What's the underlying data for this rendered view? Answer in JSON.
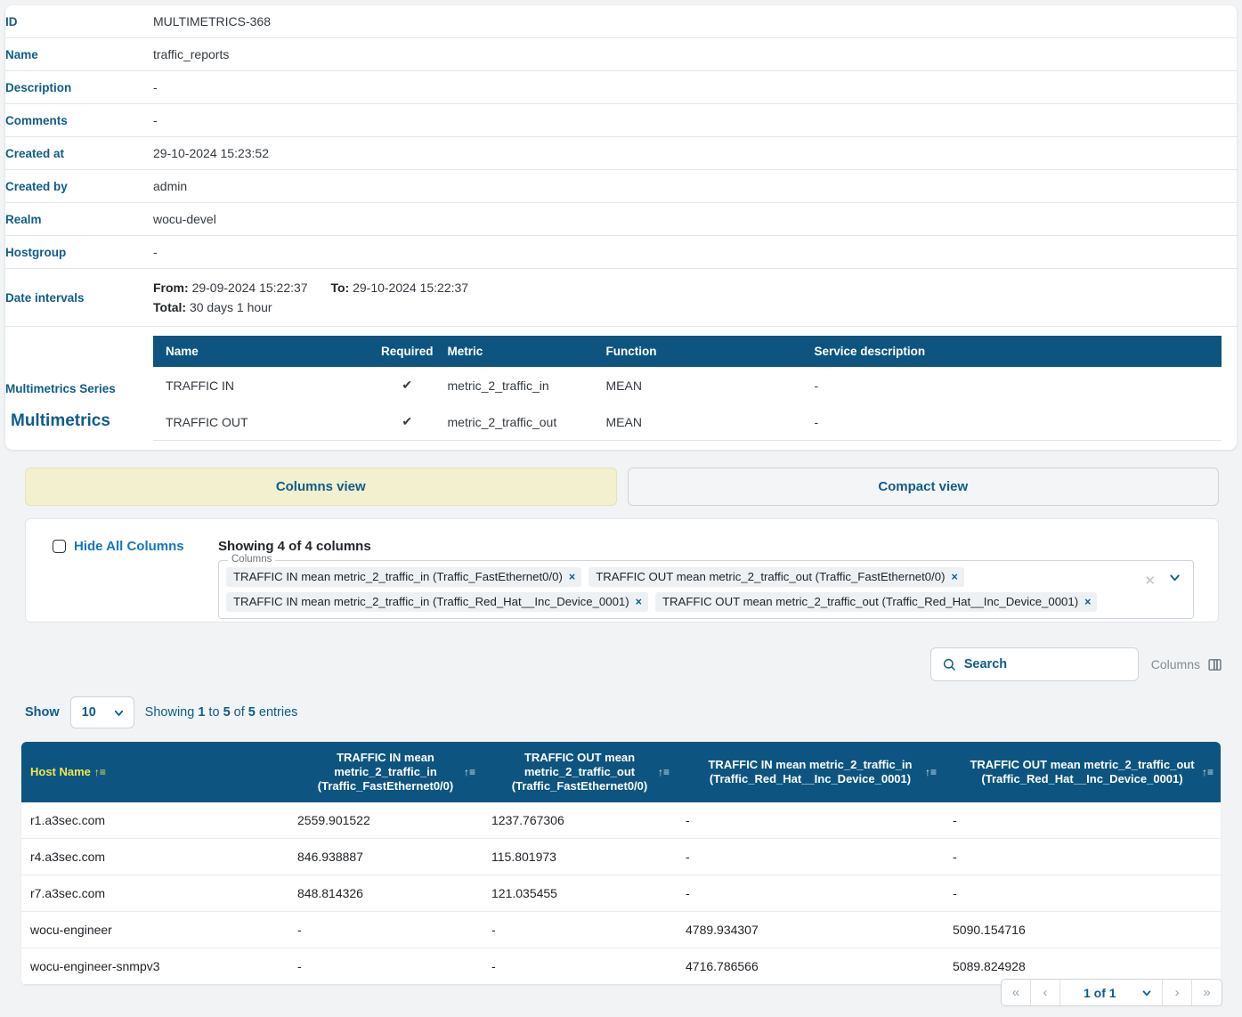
{
  "details": {
    "rows": [
      {
        "label": "ID",
        "value": "MULTIMETRICS-368"
      },
      {
        "label": "Name",
        "value": "traffic_reports"
      },
      {
        "label": "Description",
        "value": "-"
      },
      {
        "label": "Comments",
        "value": "-"
      },
      {
        "label": "Created at",
        "value": "29-10-2024 15:23:52"
      },
      {
        "label": "Created by",
        "value": "admin"
      },
      {
        "label": "Realm",
        "value": "wocu-devel"
      },
      {
        "label": "Hostgroup",
        "value": "-"
      }
    ],
    "date_intervals": {
      "label": "Date intervals",
      "from_label": "From:",
      "from_value": "29-09-2024 15:22:37",
      "to_label": "To:",
      "to_value": "29-10-2024 15:22:37",
      "total_label": "Total:",
      "total_value": "30 days 1 hour"
    },
    "series": {
      "label": "Multimetrics Series",
      "headers": [
        "Name",
        "Required",
        "Metric",
        "Function",
        "Service description"
      ],
      "rows": [
        {
          "name": "TRAFFIC IN",
          "required": "✔",
          "metric": "metric_2_traffic_in",
          "function": "MEAN",
          "service_description": "-"
        },
        {
          "name": "TRAFFIC OUT",
          "required": "✔",
          "metric": "metric_2_traffic_out",
          "function": "MEAN",
          "service_description": "-"
        }
      ]
    }
  },
  "multimetrics": {
    "title": "Multimetrics",
    "views": {
      "columns_view": "Columns view",
      "compact_view": "Compact view"
    },
    "columns_panel": {
      "hide_all_label": "Hide All Columns",
      "showing_columns": "Showing 4 of 4 columns",
      "field_legend": "Columns",
      "chips": [
        "TRAFFIC IN mean metric_2_traffic_in (Traffic_FastEthernet0/0)",
        "TRAFFIC OUT mean metric_2_traffic_out (Traffic_FastEthernet0/0)",
        "TRAFFIC IN mean metric_2_traffic_in (Traffic_Red_Hat__Inc_Device_0001)",
        "TRAFFIC OUT mean metric_2_traffic_out (Traffic_Red_Hat__Inc_Device_0001)"
      ],
      "chip_remove": "×",
      "clear_all": "✕",
      "caret": "⌄"
    },
    "toolbar": {
      "search_placeholder": "Search",
      "columns_button": "Columns"
    },
    "show_entries": {
      "show_label": "Show",
      "page_size": "10",
      "info": "Showing 1 to 5 of 5 entries",
      "info_parts": {
        "prefix": "Showing ",
        "from": "1",
        "mid": " to ",
        "to": "5",
        "mid2": " of ",
        "total": "5",
        "suffix": " entries"
      }
    },
    "table": {
      "headers": [
        {
          "line1": "Host Name",
          "line2": "",
          "line3": ""
        },
        {
          "line1": "TRAFFIC IN mean",
          "line2": "metric_2_traffic_in",
          "line3": "(Traffic_FastEthernet0/0)"
        },
        {
          "line1": "TRAFFIC OUT mean",
          "line2": "metric_2_traffic_out",
          "line3": "(Traffic_FastEthernet0/0)"
        },
        {
          "line1": "TRAFFIC IN mean metric_2_traffic_in",
          "line2": "(Traffic_Red_Hat__Inc_Device_0001)",
          "line3": ""
        },
        {
          "line1": "TRAFFIC OUT mean metric_2_traffic_out",
          "line2": "(Traffic_Red_Hat__Inc_Device_0001)",
          "line3": ""
        }
      ],
      "rows": [
        {
          "host": "r1.a3sec.com",
          "in_fe": "2559.901522",
          "out_fe": "1237.767306",
          "in_rh": "-",
          "out_rh": "-"
        },
        {
          "host": "r4.a3sec.com",
          "in_fe": "846.938887",
          "out_fe": "115.801973",
          "in_rh": "-",
          "out_rh": "-"
        },
        {
          "host": "r7.a3sec.com",
          "in_fe": "848.814326",
          "out_fe": "121.035455",
          "in_rh": "-",
          "out_rh": "-"
        },
        {
          "host": "wocu-engineer",
          "in_fe": "-",
          "out_fe": "-",
          "in_rh": "4789.934307",
          "out_rh": "5090.154716"
        },
        {
          "host": "wocu-engineer-snmpv3",
          "in_fe": "-",
          "out_fe": "-",
          "in_rh": "4716.786566",
          "out_rh": "5089.824928"
        }
      ]
    },
    "pagination": {
      "first": "«",
      "prev": "‹",
      "current": "1 of 1",
      "next": "›",
      "last": "»"
    }
  },
  "colors": {
    "header_blue": "#0d5580",
    "accent_blue": "#0f5c8c",
    "active_tab_yellow": "#f2f0ce",
    "sort_active_yellow": "#f2e64d",
    "page_bg": "#f1f3f5"
  }
}
